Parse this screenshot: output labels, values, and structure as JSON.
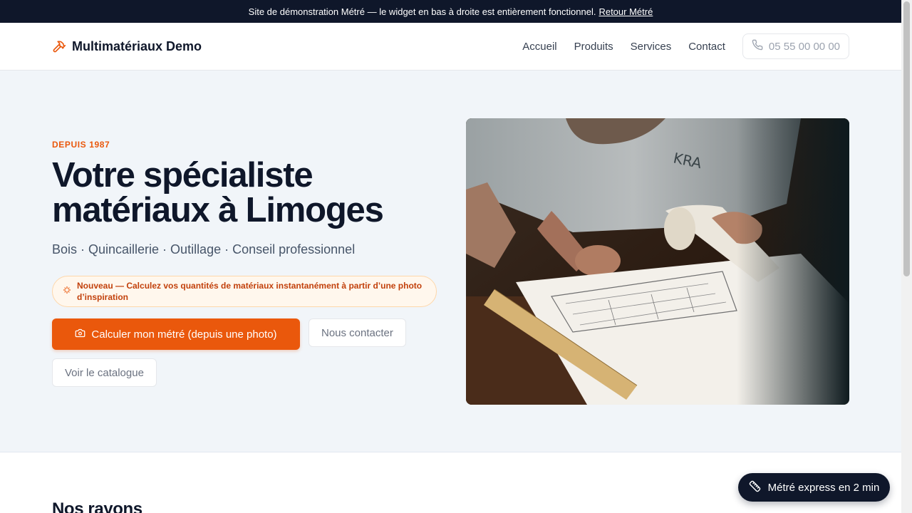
{
  "banner": {
    "text": "Site de démonstration Métré — le widget en bas à droite est entièrement fonctionnel.",
    "link": "Retour Métré"
  },
  "header": {
    "brand": "Multimatériaux Demo",
    "brand_icon": "hammer-icon",
    "nav": [
      "Accueil",
      "Produits",
      "Services",
      "Contact"
    ],
    "phone": "05 55 00 00 00",
    "phone_icon": "phone-icon"
  },
  "hero": {
    "eyebrow": "DEPUIS 1987",
    "title": "Votre spécialiste matériaux à Limoges",
    "subtitle": "Bois · Quincaillerie · Outillage · Conseil professionnel",
    "promo": "Nouveau — Calculez vos quantités de matériaux instantanément à partir d’une photo d’inspiration",
    "promo_icon": "sparkles-icon",
    "primary_cta": "Calculer mon métré (depuis une photo)",
    "primary_icon": "camera-icon",
    "secondary_cta": "Nous contacter",
    "tertiary_cta": "Voir le catalogue",
    "image_icon": "architect-drawing-photo"
  },
  "section": {
    "title": "Nos rayons"
  },
  "widget": {
    "label": "Métré express en 2 min",
    "icon": "ruler-icon"
  },
  "colors": {
    "accent": "#ea580c",
    "dark": "#0f172a",
    "promo_bg": "#fff7ed",
    "hero_bg": "#f1f5f9"
  }
}
